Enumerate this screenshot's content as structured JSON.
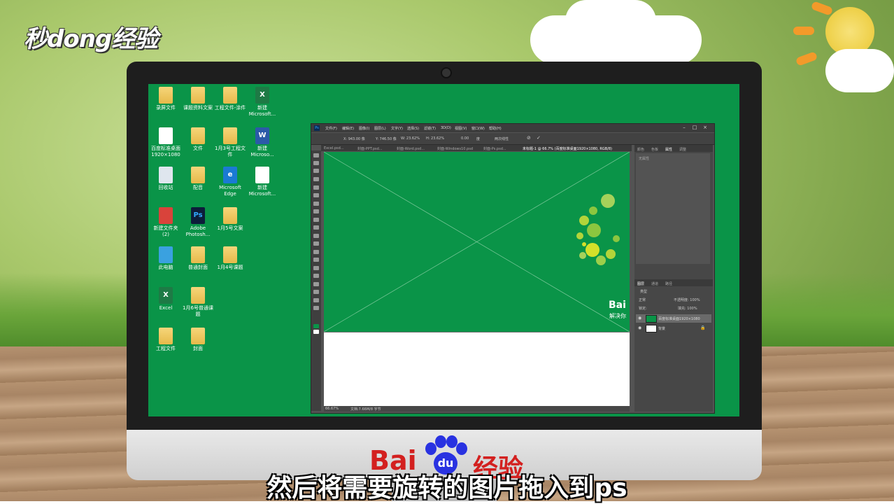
{
  "watermark_logo": "秒dong经验",
  "subtitle": "然后将需要旋转的图片拖入到ps",
  "footer_brand": {
    "left": "Bai",
    "right": "经验",
    "paw": "du"
  },
  "desktop": {
    "icons": [
      {
        "label": "录屏文件",
        "glyph": "",
        "kind": "folder"
      },
      {
        "label": "课题资料文案",
        "glyph": "",
        "kind": "folder"
      },
      {
        "label": "工程文件-涂件",
        "glyph": "",
        "kind": "folder"
      },
      {
        "label": "新建 Microsoft...",
        "glyph": "X",
        "kind": "xl"
      },
      {
        "label": "百度标准桌面1920×1080",
        "glyph": "",
        "kind": "doc"
      },
      {
        "label": "文件",
        "glyph": "",
        "kind": "folder"
      },
      {
        "label": "1月3号工程文件",
        "glyph": "",
        "kind": "folder"
      },
      {
        "label": "新建 Microso...",
        "glyph": "W",
        "kind": "wd"
      },
      {
        "label": "回收站",
        "glyph": "",
        "kind": "bin"
      },
      {
        "label": "配音",
        "glyph": "",
        "kind": "folder"
      },
      {
        "label": "Microsoft Edge",
        "glyph": "e",
        "kind": "edge"
      },
      {
        "label": "新建 Microsoft...",
        "glyph": "",
        "kind": "doc"
      },
      {
        "label": "新建文件夹 (2)",
        "glyph": "",
        "kind": "red"
      },
      {
        "label": "Adobe Photosh...",
        "glyph": "Ps",
        "kind": "ps"
      },
      {
        "label": "1月5号文案",
        "glyph": "",
        "kind": "folder"
      },
      {
        "label": "此电脑",
        "glyph": "",
        "kind": "pc"
      },
      {
        "label": "普通封面",
        "glyph": "",
        "kind": "folder"
      },
      {
        "label": "1月4号课题",
        "glyph": "",
        "kind": "folder"
      },
      {
        "label": "Excel",
        "glyph": "X",
        "kind": "xl"
      },
      {
        "label": "1月6号普通课题",
        "glyph": "",
        "kind": "folder"
      },
      {
        "label": "工程文件",
        "glyph": "",
        "kind": "folder"
      },
      {
        "label": "封面",
        "glyph": "",
        "kind": "folder"
      }
    ]
  },
  "photoshop": {
    "menu": [
      "文件(F)",
      "编辑(E)",
      "图像(I)",
      "图层(L)",
      "文字(Y)",
      "选择(S)",
      "滤镜(T)",
      "3D(D)",
      "视图(V)",
      "窗口(W)",
      "帮助(H)"
    ],
    "options": {
      "x": "X: 943.00 像",
      "y": "Y: 746.50 像",
      "w": "W: 23.62%",
      "h": "H: 23.62%",
      "angle": "0.00",
      "degree": "度",
      "interp": "两次线性"
    },
    "tabs": [
      "Excel.psd...",
      "封面-PPT.psd...",
      "封面-Word.psd...",
      "封面-Windows10.psd",
      "封面-Ps.psd...",
      "未标题-1 @ 66.7% (百度标准桌面1920×1080, RGB/8)"
    ],
    "canvas": {
      "bai_text": "Bai",
      "bai_sub": "解决你"
    },
    "status": {
      "zoom": "66.67%",
      "doc": "文档:7.66M/8 字节"
    },
    "properties_tabs": [
      "颜色",
      "色板",
      "属性",
      "调整"
    ],
    "properties_empty": "无属性",
    "layers_tabs": [
      "图层",
      "通道",
      "路径"
    ],
    "blend_mode": "正常",
    "opacity_label": "不透明度: 100%",
    "fill_label": "填充: 100%",
    "lock_label": "锁定:",
    "kind_label": "类型",
    "layers": [
      {
        "name": "百度标准桌面1920×1080",
        "eye": "👁",
        "thumb_color": "#0a9448"
      },
      {
        "name": "背景",
        "eye": "👁",
        "thumb_color": "#ffffff"
      }
    ],
    "window_btns": {
      "min": "–",
      "max": "□",
      "close": "×"
    }
  }
}
